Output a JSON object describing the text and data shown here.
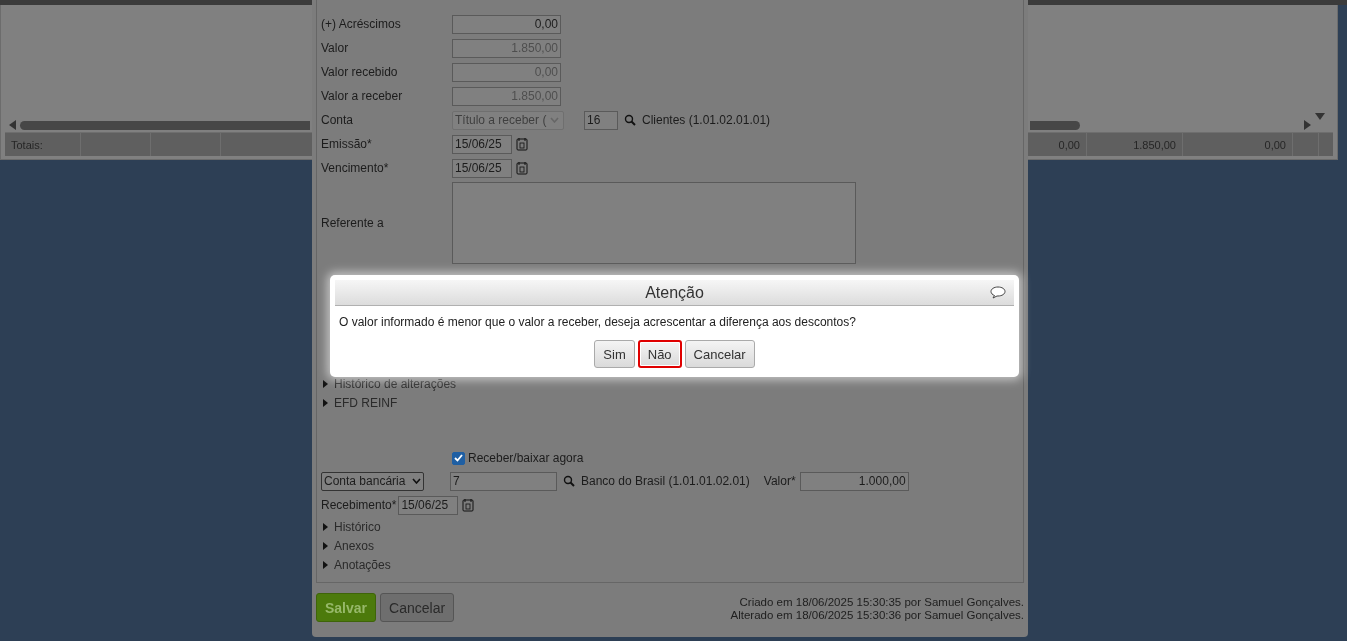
{
  "grid": {
    "totals_label": "Totais:",
    "totals": [
      "0,00",
      "1.850,00",
      "0,00"
    ]
  },
  "form": {
    "amounts": [
      {
        "label": "(+) Acréscimos",
        "value": "0,00",
        "disabled": false
      },
      {
        "label": "Valor",
        "value": "1.850,00",
        "disabled": true
      },
      {
        "label": "Valor recebido",
        "value": "0,00",
        "disabled": true
      },
      {
        "label": "Valor a receber",
        "value": "1.850,00",
        "disabled": true
      }
    ],
    "conta": {
      "label": "Conta",
      "select": "Título a receber (",
      "disabled": true,
      "code": "16",
      "account": "Clientes (1.01.02.01.01)"
    },
    "dates": [
      {
        "label": "Emissão*",
        "value": "15/06/25"
      },
      {
        "label": "Vencimento*",
        "value": "15/06/25"
      }
    ],
    "referente": {
      "label": "Referente a"
    },
    "sections_top": [
      {
        "label": "Histórico de alterações",
        "expanded": false
      },
      {
        "label": "EFD REINF",
        "expanded": false
      }
    ],
    "receive": {
      "checked": true,
      "label": "Receber/baixar agora",
      "select": "Conta bancária",
      "code": "7",
      "account": "Banco do Brasil (1.01.01.02.01)",
      "valor_label": "Valor*",
      "valor": "1.000,00",
      "date_label": "Recebimento*",
      "date": "15/06/25"
    },
    "sections_bottom": [
      {
        "label": "Histórico",
        "expanded": false
      },
      {
        "label": "Anexos",
        "expanded": false
      },
      {
        "label": "Anotações",
        "expanded": false
      }
    ],
    "buttons": [
      {
        "label": "Salvar",
        "kind": "primary"
      },
      {
        "label": "Cancelar",
        "kind": "secondary"
      }
    ],
    "audit": [
      "Criado em 18/06/2025 15:30:35 por Samuel Gonçalves.",
      "Alterado em 18/06/2025 15:30:36 por Samuel Gonçalves."
    ]
  },
  "dialog": {
    "title": "Atenção",
    "message": "O valor informado é menor que o valor a receber, deseja acrescentar a diferença aos descontos?",
    "buttons": [
      {
        "label": "Sim",
        "highlighted": false
      },
      {
        "label": "Não",
        "highlighted": true
      },
      {
        "label": "Cancelar",
        "highlighted": false
      }
    ]
  }
}
